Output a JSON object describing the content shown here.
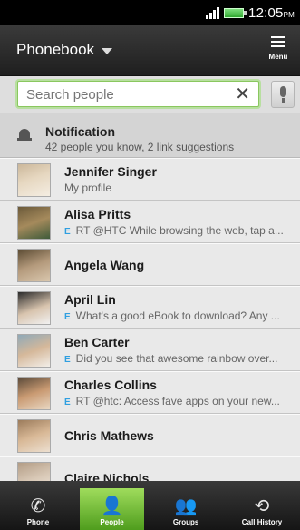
{
  "status_bar": {
    "time": "12:05",
    "ampm": "PM"
  },
  "header": {
    "title": "Phonebook",
    "menu_label": "Menu"
  },
  "search": {
    "placeholder": "Search people",
    "clear": "✕"
  },
  "notification": {
    "title": "Notification",
    "subtitle": "42 people you know, 2 link suggestions"
  },
  "contacts": [
    {
      "name": "Jennifer Singer",
      "sub": "My profile",
      "twitter": false
    },
    {
      "name": "Alisa Pritts",
      "sub": "RT @HTC While browsing the web, tap a...",
      "twitter": true
    },
    {
      "name": "Angela Wang",
      "sub": "",
      "twitter": false
    },
    {
      "name": "April Lin",
      "sub": "What's a good eBook to download? Any ...",
      "twitter": true
    },
    {
      "name": "Ben Carter",
      "sub": "Did you see that awesome rainbow over...",
      "twitter": true
    },
    {
      "name": "Charles Collins",
      "sub": "RT @htc: Access fave apps on your new...",
      "twitter": true
    },
    {
      "name": "Chris Mathews",
      "sub": "",
      "twitter": false
    },
    {
      "name": "Claire Nichols",
      "sub": "",
      "twitter": false
    }
  ],
  "tabs": [
    {
      "label": "Phone",
      "icon": "phone-icon"
    },
    {
      "label": "People",
      "icon": "person-icon",
      "active": true
    },
    {
      "label": "Groups",
      "icon": "groups-icon"
    },
    {
      "label": "Call History",
      "icon": "call-history-icon"
    }
  ],
  "colors": {
    "accent_green": "#6fbf34",
    "twitter_blue": "#2f9fe0"
  }
}
